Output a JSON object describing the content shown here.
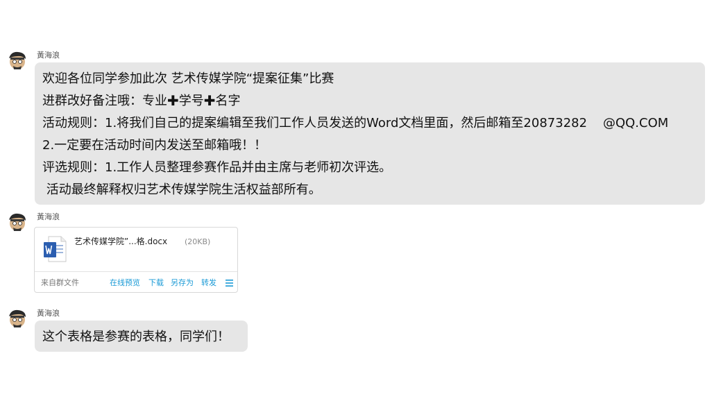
{
  "messages": [
    {
      "sender": "黃海浪",
      "lines": {
        "line1": "欢迎各位同学参加此次 艺术传媒学院“提案征集”比赛",
        "line2_a": "进群改好备注哦：专业",
        "line2_plus1": "✚",
        "line2_b": "学号",
        "line2_plus2": "✚",
        "line2_c": "名字",
        "line3": "活动规则：1.将我们自己的提案编辑至我们工作人员发送的Word文档里面，然后邮箱至20873282    @QQ.COM",
        "line4": "2.一定要在活动时间内发送至邮箱哦！！",
        "line5": "评选规则：1.工作人员整理参赛作品并由主席与老师初次评选。",
        "line6": " 活动最终解释权归艺术传媒学院生活权益部所有。"
      }
    },
    {
      "sender": "黃海浪",
      "file": {
        "icon": "word-doc-icon",
        "name": "艺术传媒学院”...格.docx",
        "size": "(20KB)",
        "source": "来自群文件",
        "actions": {
          "preview": "在线预览",
          "download": "下载",
          "save_as": "另存为",
          "forward": "转发"
        },
        "menu_icon": "menu-lines-icon"
      }
    },
    {
      "sender": "黃海浪",
      "text": "这个表格是参赛的表格，同学们！"
    }
  ],
  "colors": {
    "bubble_bg": "#e6e6e6",
    "link_blue": "#1a9ad6",
    "word_blue": "#2b5eb0"
  }
}
